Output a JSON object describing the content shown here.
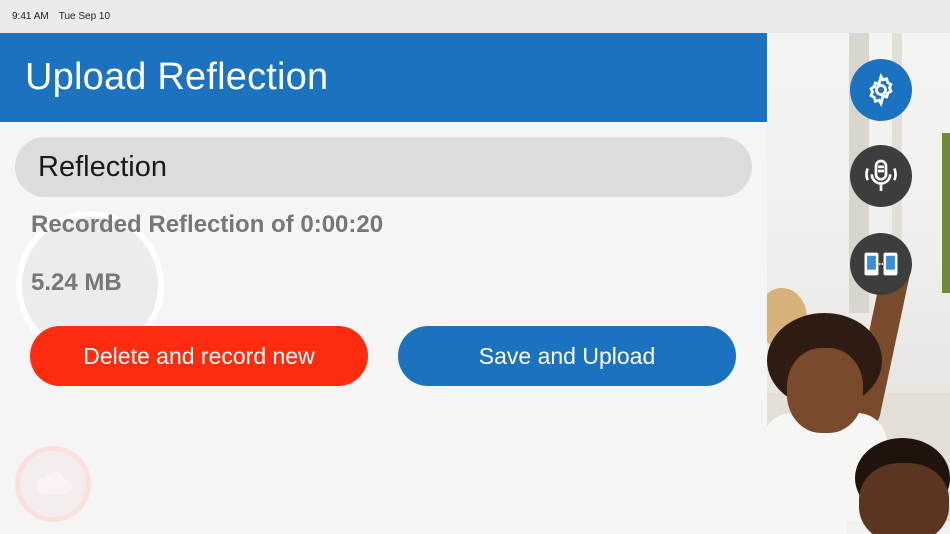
{
  "status_bar": {
    "time": "9:41 AM",
    "date": "Tue Sep 10"
  },
  "header": {
    "title": "Upload Reflection"
  },
  "reflection": {
    "title": "Reflection",
    "duration_text": "Recorded Reflection of 0:00:20",
    "size_text": "5.24 MB"
  },
  "actions": {
    "delete_label": "Delete and record new",
    "save_label": "Save and Upload"
  },
  "side_buttons": [
    {
      "icon": "gear-icon",
      "color": "#1b72bf"
    },
    {
      "icon": "microphone-icon",
      "color": "#3d3d3d"
    },
    {
      "icon": "devices-icon",
      "color": "#3d3d3d"
    }
  ],
  "colors": {
    "accent": "#1b72bf",
    "danger": "#ff2c0f",
    "dark_button": "#3d3d3d"
  }
}
